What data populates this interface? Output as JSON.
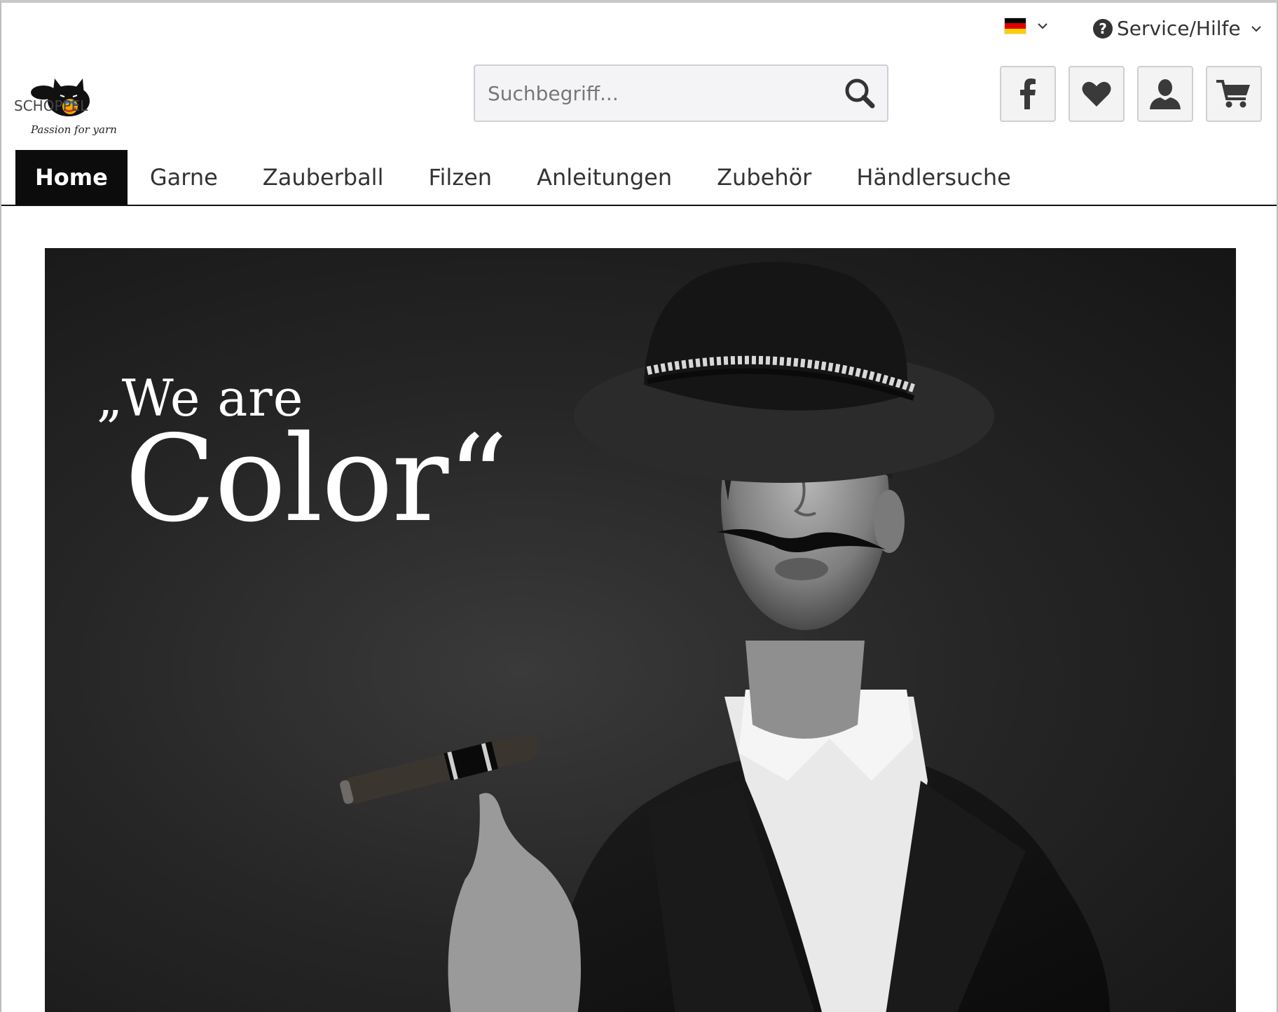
{
  "topbar": {
    "language_flag": "german-flag",
    "service_label": "Service/Hilfe"
  },
  "logo": {
    "brand_text": "SCHOPPEL",
    "tagline": "Passion for yarn"
  },
  "search": {
    "placeholder": "Suchbegriff..."
  },
  "actions": [
    "facebook-icon",
    "heart-icon",
    "user-icon",
    "cart-icon"
  ],
  "nav": {
    "items": [
      {
        "label": "Home",
        "active": true
      },
      {
        "label": "Garne",
        "active": false
      },
      {
        "label": "Zauberball",
        "active": false
      },
      {
        "label": "Filzen",
        "active": false
      },
      {
        "label": "Anleitungen",
        "active": false
      },
      {
        "label": "Zubehör",
        "active": false
      },
      {
        "label": "Händlersuche",
        "active": false
      }
    ]
  },
  "hero": {
    "line1": "„We are",
    "line2": "Color“"
  },
  "colors": {
    "nav_active_bg": "#0c0c0c",
    "hero_bg": "#262626",
    "icon_color": "#3a3a3a"
  }
}
